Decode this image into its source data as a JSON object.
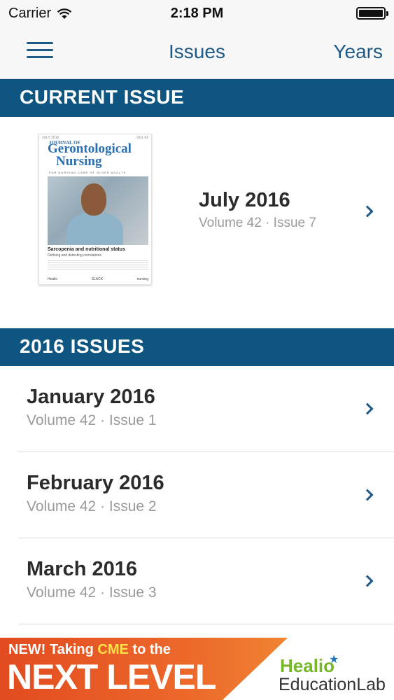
{
  "status_bar": {
    "carrier": "Carrier",
    "time": "2:18 PM",
    "wifi_icon": "wifi-icon",
    "battery_icon": "battery-icon"
  },
  "nav": {
    "menu_icon": "hamburger-menu-icon",
    "title": "Issues",
    "years_label": "Years"
  },
  "current_section": {
    "header": "CURRENT ISSUE",
    "issue": {
      "date": "July 2016",
      "volume": "Volume 42 · Issue 7",
      "cover": {
        "journal_small": "JOURNAL OF",
        "journal_line1": "Gerontological",
        "journal_line2": "Nursing",
        "tagline": "FOR NURSING CARE OF OLDER ADULTS",
        "caption": "Sarcopenia and nutritional status",
        "subcaption": "Defining and detecting correlations",
        "publisher": "SLACK"
      }
    }
  },
  "issues_section": {
    "header": "2016 ISSUES",
    "items": [
      {
        "title": "January 2016",
        "subtitle": "Volume 42 · Issue 1"
      },
      {
        "title": "February 2016",
        "subtitle": "Volume 42 · Issue 2"
      },
      {
        "title": "March 2016",
        "subtitle": "Volume 42 · Issue 3"
      }
    ]
  },
  "banner": {
    "new": "NEW!",
    "taking": " Taking ",
    "cme": "CME",
    "to_the": " to the",
    "next_level": "NEXT LEVEL",
    "brand1": "Healio",
    "brand2": "EducationLab"
  }
}
